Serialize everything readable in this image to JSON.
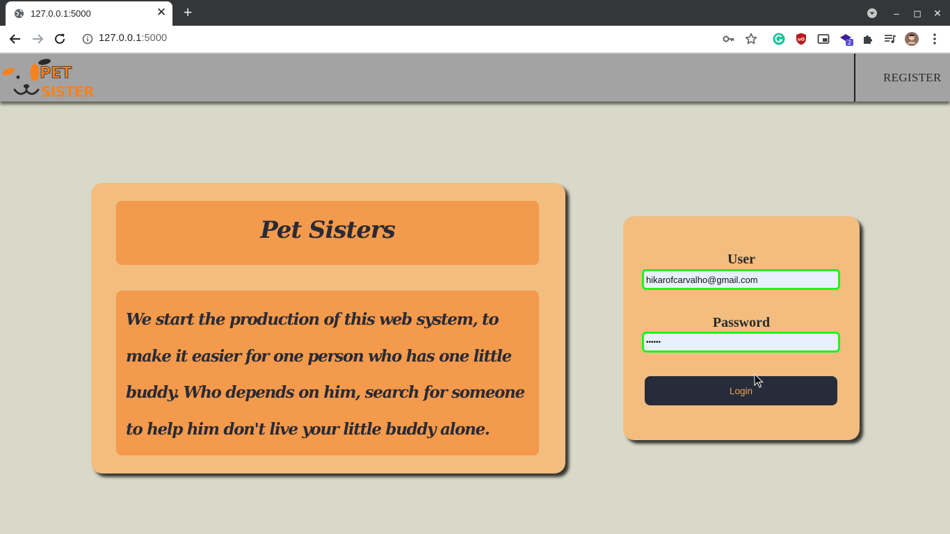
{
  "browser": {
    "tab_title": "127.0.0.1:5000",
    "tab_close_glyph": "✕",
    "new_tab_glyph": "+",
    "url_host": "127.0.0.1",
    "url_port": ":5000",
    "window_controls": {
      "minimize": "–",
      "maximize": "◻",
      "close": "✕"
    },
    "extension_badge": "2"
  },
  "header": {
    "logo_text_top": "PET",
    "logo_text_bottom": "SISTER",
    "register_label": "REGISTER"
  },
  "about": {
    "title": "Pet Sisters",
    "text": "We start the production of this web system, to make it easier for one person who has one little buddy. Who depends on him, search for someone to help him don't live your little buddy alone."
  },
  "login": {
    "user_label": "User",
    "user_value": "hikarofcarvalho@gmail.com",
    "password_label": "Password",
    "password_value": "••••••",
    "button_label": "Login"
  },
  "colors": {
    "page_bg": "#d8d9c9",
    "header_bg": "#a3a3a3",
    "card_bg": "#f2bd7e",
    "card_inner": "#f39a4c",
    "input_border": "#1ff21f",
    "button_bg": "#262c3a",
    "button_text": "#f2a45a",
    "logo_orange": "#f5821f"
  }
}
